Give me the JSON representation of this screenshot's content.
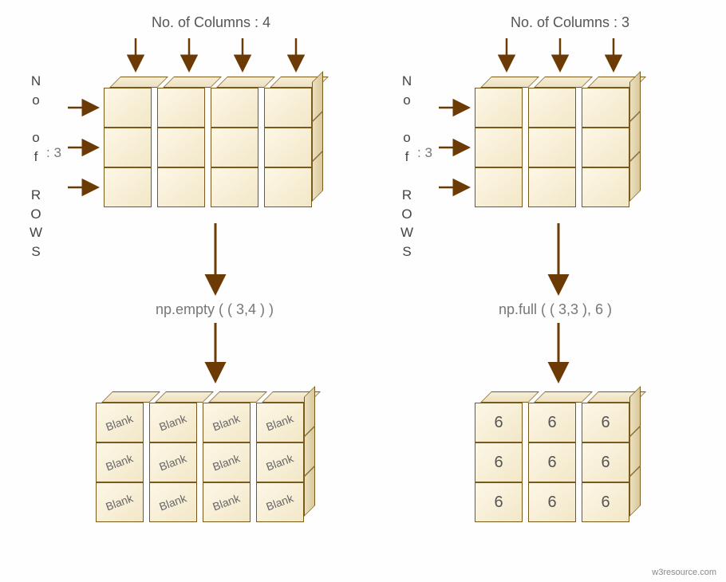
{
  "left": {
    "col_label": "No. of Columns : 4",
    "row_label_letters": [
      "N",
      "o",
      " ",
      "o",
      "f",
      " ",
      "R",
      "O",
      "W",
      "S"
    ],
    "row_count": ": 3",
    "func": "np.empty ( ( 3,4 ) )",
    "rows": 3,
    "cols": 4,
    "result_label": "Blank"
  },
  "right": {
    "col_label": "No. of Columns : 3",
    "row_label_letters": [
      "N",
      "o",
      " ",
      "o",
      "f",
      " ",
      "R",
      "O",
      "W",
      "S"
    ],
    "row_count": ": 3",
    "func": "np.full ( ( 3,3 ), 6 )",
    "rows": 3,
    "cols": 3,
    "result_label": "6"
  },
  "footer": "w3resource.com"
}
